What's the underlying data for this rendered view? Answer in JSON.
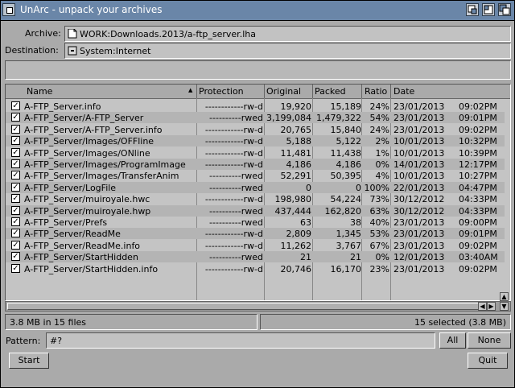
{
  "window": {
    "title": "UnArc - unpack your archives"
  },
  "archive": {
    "label": "Archive:",
    "value": "WORK:Downloads.2013/a-ftp_server.lha"
  },
  "destination": {
    "label": "Destination:",
    "value": "System:Internet"
  },
  "columns": {
    "name": "Name",
    "protection": "Protection",
    "original": "Original",
    "packed": "Packed",
    "ratio": "Ratio",
    "date": "Date"
  },
  "files": [
    {
      "name": "A-FTP_Server.info",
      "prot": "------------rw-d",
      "orig": "19,920",
      "packed": "15,189",
      "ratio": "24%",
      "date": "23/01/2013",
      "time": "09:02PM"
    },
    {
      "name": "A-FTP_Server/A-FTP_Server",
      "prot": "----------rwed",
      "orig": "3,199,084",
      "packed": "1,479,322",
      "ratio": "54%",
      "date": "23/01/2013",
      "time": "09:01PM"
    },
    {
      "name": "A-FTP_Server/A-FTP_Server.info",
      "prot": "------------rw-d",
      "orig": "20,765",
      "packed": "15,840",
      "ratio": "24%",
      "date": "23/01/2013",
      "time": "09:02PM"
    },
    {
      "name": "A-FTP_Server/Images/OFFline",
      "prot": "------------rw-d",
      "orig": "5,188",
      "packed": "5,122",
      "ratio": "2%",
      "date": "10/01/2013",
      "time": "10:32PM"
    },
    {
      "name": "A-FTP_Server/Images/ONline",
      "prot": "------------rw-d",
      "orig": "11,481",
      "packed": "11,438",
      "ratio": "1%",
      "date": "10/01/2013",
      "time": "10:39PM"
    },
    {
      "name": "A-FTP_Server/Images/ProgramImage",
      "prot": "------------rw-d",
      "orig": "4,186",
      "packed": "4,186",
      "ratio": "0%",
      "date": "14/01/2013",
      "time": "12:17PM"
    },
    {
      "name": "A-FTP_Server/Images/TransferAnim",
      "prot": "----------rwed",
      "orig": "52,291",
      "packed": "50,395",
      "ratio": "4%",
      "date": "10/01/2013",
      "time": "10:27PM"
    },
    {
      "name": "A-FTP_Server/LogFile",
      "prot": "----------rwed",
      "orig": "0",
      "packed": "0",
      "ratio": "100%",
      "date": "22/01/2013",
      "time": "04:47PM"
    },
    {
      "name": "A-FTP_Server/muiroyale.hwc",
      "prot": "------------rw-d",
      "orig": "198,980",
      "packed": "54,224",
      "ratio": "73%",
      "date": "30/12/2012",
      "time": "04:33PM"
    },
    {
      "name": "A-FTP_Server/muiroyale.hwp",
      "prot": "----------rwed",
      "orig": "437,444",
      "packed": "162,820",
      "ratio": "63%",
      "date": "30/12/2012",
      "time": "04:33PM"
    },
    {
      "name": "A-FTP_Server/Prefs",
      "prot": "----------rwed",
      "orig": "63",
      "packed": "38",
      "ratio": "40%",
      "date": "23/01/2013",
      "time": "09:00PM"
    },
    {
      "name": "A-FTP_Server/ReadMe",
      "prot": "------------rw-d",
      "orig": "2,809",
      "packed": "1,345",
      "ratio": "53%",
      "date": "23/01/2013",
      "time": "09:01PM"
    },
    {
      "name": "A-FTP_Server/ReadMe.info",
      "prot": "------------rw-d",
      "orig": "11,262",
      "packed": "3,767",
      "ratio": "67%",
      "date": "23/01/2013",
      "time": "09:02PM"
    },
    {
      "name": "A-FTP_Server/StartHidden",
      "prot": "----------rwed",
      "orig": "21",
      "packed": "21",
      "ratio": "0%",
      "date": "12/01/2013",
      "time": "03:40AM"
    },
    {
      "name": "A-FTP_Server/StartHidden.info",
      "prot": "------------rw-d",
      "orig": "20,746",
      "packed": "16,170",
      "ratio": "23%",
      "date": "23/01/2013",
      "time": "09:02PM"
    }
  ],
  "status": {
    "left": "3.8 MB in 15 files",
    "right": "15 selected (3.8 MB)"
  },
  "pattern": {
    "label": "Pattern:",
    "value": "#?"
  },
  "buttons": {
    "all": "All",
    "none": "None",
    "start": "Start",
    "quit": "Quit"
  }
}
